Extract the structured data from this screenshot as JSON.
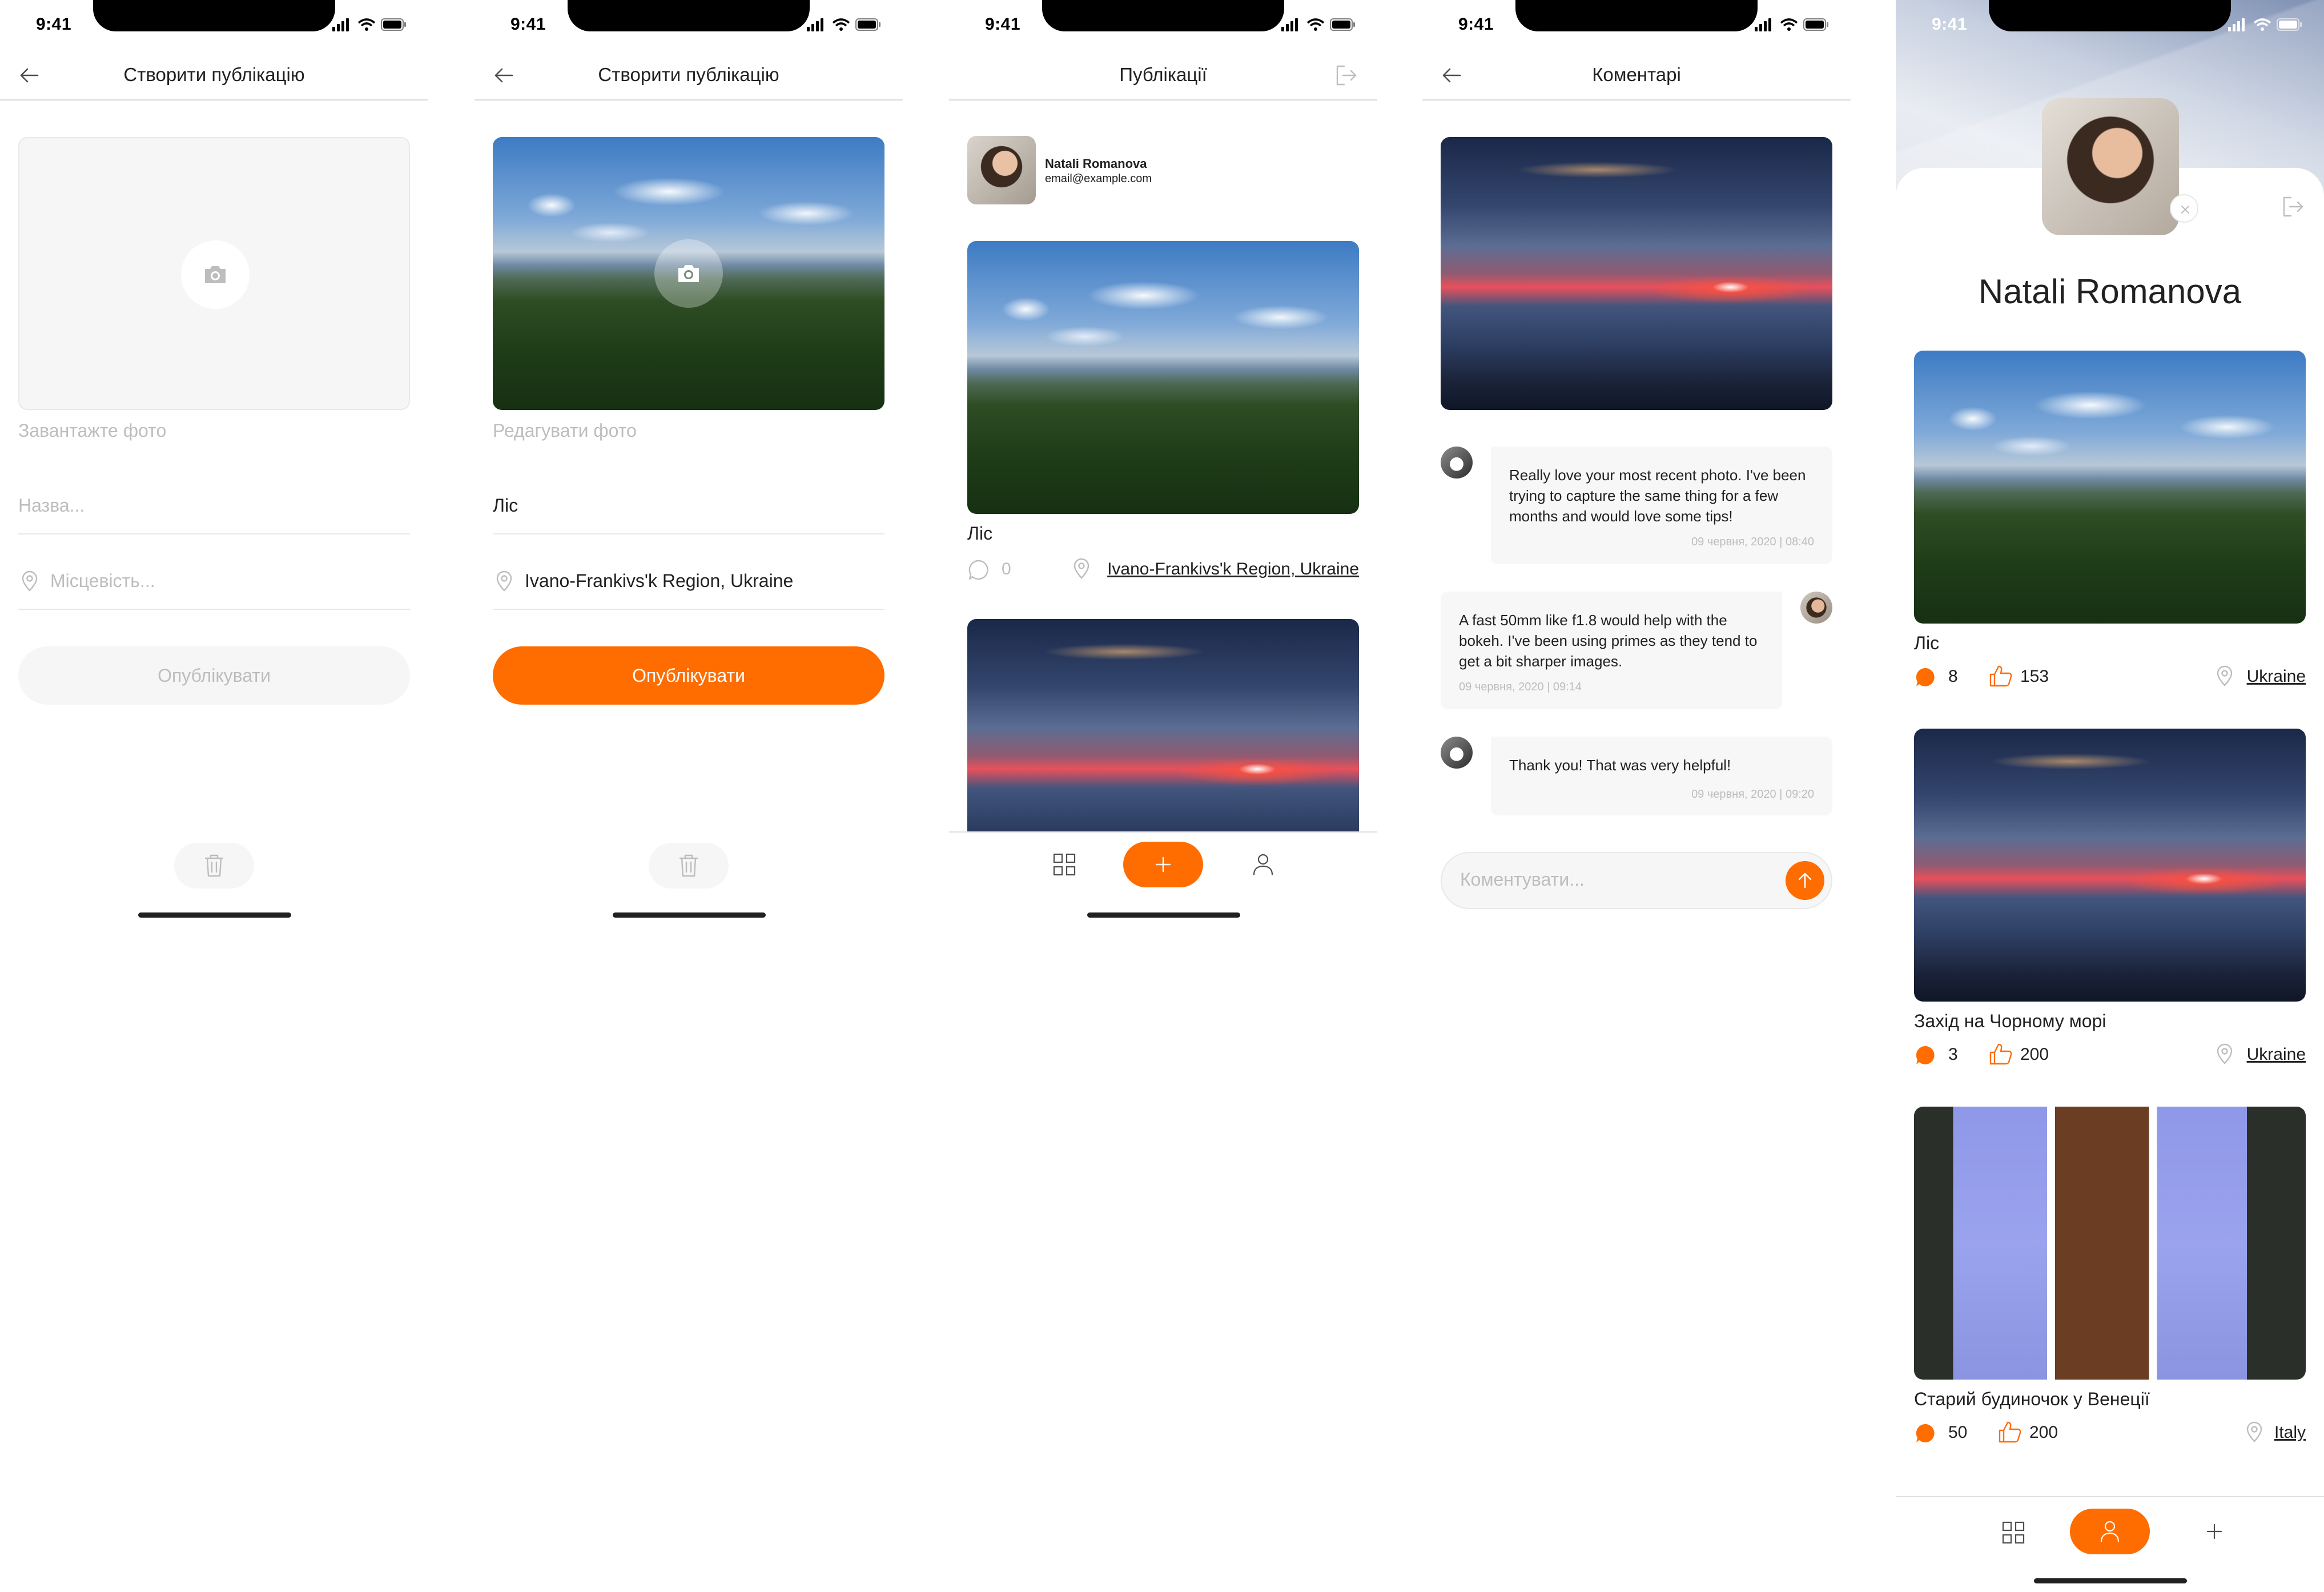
{
  "status": {
    "time": "9:41"
  },
  "create_empty": {
    "title": "Створити публікацію",
    "photo_caption": "Завантажте фото",
    "name_placeholder": "Назва...",
    "location_placeholder": "Місцевість...",
    "publish_label": "Опублікувати"
  },
  "create_filled": {
    "title": "Створити публікацію",
    "photo_caption": "Редагувати фото",
    "name_value": "Ліс",
    "location_value": "Ivano-Frankivs'k Region, Ukraine",
    "publish_label": "Опублікувати"
  },
  "feed": {
    "title": "Публікації",
    "user": {
      "name": "Natali Romanova",
      "email": "email@example.com"
    },
    "posts": [
      {
        "title": "Ліс",
        "comments": "0",
        "location": "Ivano-Frankivs'k Region, Ukraine"
      }
    ]
  },
  "comments": {
    "title": "Коментарі",
    "items": [
      {
        "text": "Really love your most recent photo. I've been trying to capture the same thing for a few months and would love some tips!",
        "date": "09 червня, 2020 | 08:40"
      },
      {
        "text": "A fast 50mm like f1.8 would help with the bokeh. I've been using primes as they tend to get a bit sharper images.",
        "date": "09 червня, 2020 | 09:14"
      },
      {
        "text": "Thank you! That was very helpful!",
        "date": "09 червня, 2020 | 09:20"
      }
    ],
    "input_placeholder": "Коментувати..."
  },
  "profile": {
    "name": "Natali Romanova",
    "posts": [
      {
        "title": "Ліс",
        "comments": "8",
        "likes": "153",
        "location": "Ukraine"
      },
      {
        "title": "Захід на Чорному морі",
        "comments": "3",
        "likes": "200",
        "location": "Ukraine"
      },
      {
        "title": "Старий будиночок у Венеції",
        "comments": "50",
        "likes": "200",
        "location": "Italy"
      }
    ]
  },
  "colors": {
    "accent": "#ff6c00",
    "placeholder": "#bdbdbd",
    "text": "#212121",
    "field_bg": "#f6f6f6"
  },
  "icons": [
    "arrow-left-icon",
    "camera-icon",
    "map-pin-icon",
    "trash-icon",
    "logout-icon",
    "comment-icon",
    "like-icon",
    "grid-icon",
    "plus-icon",
    "user-icon",
    "arrow-up-icon",
    "close-icon"
  ]
}
